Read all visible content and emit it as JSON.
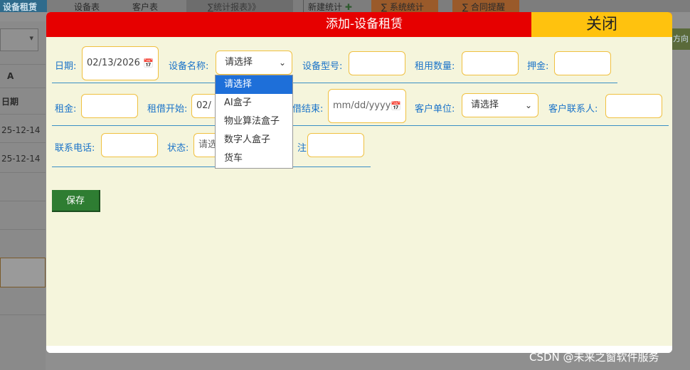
{
  "background": {
    "tabs": [
      "设备租赁",
      "设备表",
      "客户表",
      "∑统计报表》》",
      "新建统计",
      "∑ 系统统计",
      "∑ 合同提醒"
    ],
    "column_letter": "A",
    "column_header": "日期",
    "rows": [
      "25-12-14",
      "25-12-14"
    ],
    "right_button": "方向",
    "select_arrow": "▾"
  },
  "modal": {
    "title": "添加-设备租赁",
    "close_label": "关闭",
    "save_label": "保存",
    "fields": {
      "date": {
        "label": "日期:",
        "value": "02/13/2026"
      },
      "device_name": {
        "label": "设备名称:",
        "selected": "请选择"
      },
      "device_model": {
        "label": "设备型号:",
        "value": ""
      },
      "rent_qty": {
        "label": "租用数量:",
        "value": ""
      },
      "deposit": {
        "label": "押金:",
        "value": ""
      },
      "rent": {
        "label": "租金:",
        "value": ""
      },
      "rent_start": {
        "label": "租借开始:",
        "value": "02/"
      },
      "rent_end": {
        "label": "借结束:",
        "placeholder": "mm/dd/yyyy"
      },
      "customer_unit": {
        "label": "客户单位:",
        "selected": "请选择"
      },
      "customer_contact": {
        "label": "客户联系人:",
        "value": ""
      },
      "phone": {
        "label": "联系电话:",
        "value": ""
      },
      "status": {
        "label": "状态:",
        "selected": "请选"
      },
      "remark": {
        "label": "注:",
        "value": ""
      }
    },
    "device_options": [
      "请选择",
      "AI盒子",
      "物业算法盒子",
      "数字人盒子",
      "货车"
    ]
  },
  "icons": {
    "calendar": "📅",
    "chevron_down": "⌄",
    "plus_icon": "✚"
  },
  "watermark": "CSDN @未来之窗软件服务",
  "colors": {
    "header_red": "#e60000",
    "close_yellow": "#ffc20e",
    "modal_bg": "#f5f5dc",
    "label_blue": "#1a73c9",
    "save_green": "#2e7d32",
    "option_selected_blue": "#1e6fd9"
  }
}
